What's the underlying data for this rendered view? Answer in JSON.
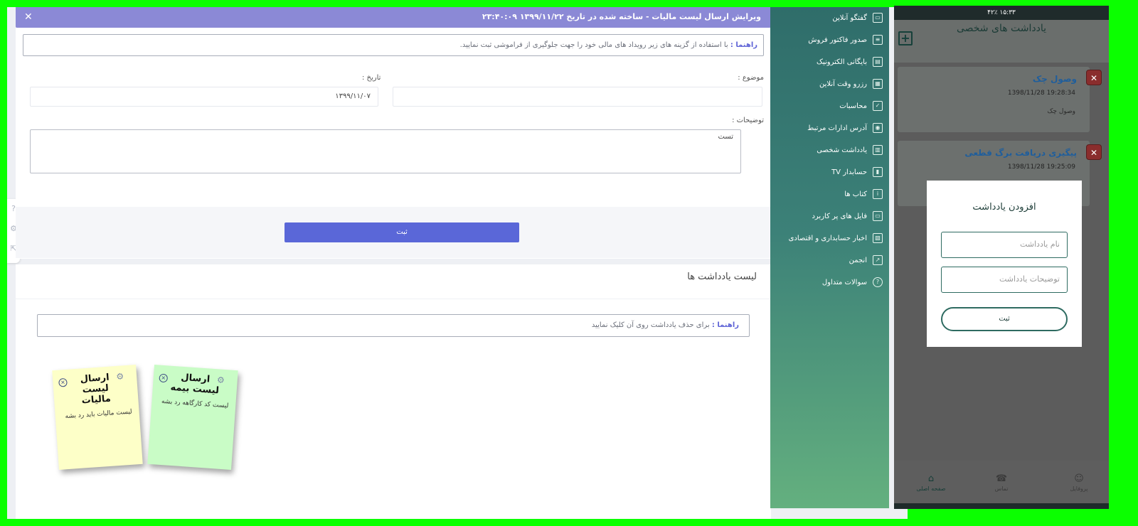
{
  "web": {
    "modal": {
      "title": "ویرایش ارسال لیست مالیات - ساخته شده در تاریخ ۱۳۹۹/۱۱/۲۲ ۲۳:۴۰:۰۹",
      "close": "✕"
    },
    "hint": {
      "label": "راهنما :",
      "text": "با استفاده از گزینه های زیر رویداد های مالی خود را جهت جلوگیری از فراموشی ثبت نمایید."
    },
    "form": {
      "subject_label": "موضوع :",
      "subject_value": "",
      "date_label": "تاریخ :",
      "date_value": "۱۳۹۹/۱۱/۰۷",
      "desc_label": "توضیحات :",
      "desc_value": "تست",
      "submit_label": "ثبت"
    },
    "list": {
      "title": "لیست یادداشت ها",
      "hint_label": "راهنما :",
      "hint_text": "برای حذف یادداشت روی آن کلیک نمایید"
    },
    "notes": [
      {
        "title": "ارسال لیست مالیات",
        "body": "لیست مالیات باید رد بشه",
        "color": "#fdffc8"
      },
      {
        "title": "ارسال لیست بیمه",
        "body": "لیست کد کارگاهه رد بشه",
        "color": "#c9fcc6"
      }
    ]
  },
  "sidebar": {
    "items": [
      {
        "label": "گفتگو آنلاین",
        "icon": "chat-icon"
      },
      {
        "label": "صدور فاکتور فروش",
        "icon": "invoice-icon"
      },
      {
        "label": "بایگانی الکترونیک",
        "icon": "archive-icon"
      },
      {
        "label": "رزرو وقت آنلاین",
        "icon": "calendar-icon"
      },
      {
        "label": "محاسبات",
        "icon": "clipboard-icon"
      },
      {
        "label": "آدرس ادارات مرتبط",
        "icon": "map-pin-icon"
      },
      {
        "label": "یادداشت شخصی",
        "icon": "notes-icon"
      },
      {
        "label": "حسابدار TV",
        "icon": "film-icon"
      },
      {
        "label": "کتاب ها",
        "icon": "book-icon"
      },
      {
        "label": "فایل های پر کاربرد",
        "icon": "file-icon"
      },
      {
        "label": "اخبار حسابداری و اقتصادی",
        "icon": "news-icon"
      },
      {
        "label": "انجمن",
        "icon": "forum-icon"
      },
      {
        "label": "سوالات متداول",
        "icon": "question-icon"
      }
    ]
  },
  "phone": {
    "status": "۱۵:۳۳  ۴۲٪",
    "title": "یادداشت های شخصی",
    "notes": [
      {
        "title": "وصول چک",
        "date": "1398/11/28 19:28:34",
        "desc": "وصول چک"
      },
      {
        "title": "پیگیری دریافت برگ قطعی",
        "date": "1398/11/28 19:25:09",
        "desc": ""
      }
    ],
    "dialog": {
      "title": "افزودن یادداشت",
      "name_placeholder": "نام یادداشت",
      "desc_placeholder": "توضیحات یادداشت",
      "submit": "ثبت"
    },
    "nav": {
      "profile": "پروفایل",
      "contact": "تماس",
      "home": "صفحه اصلی"
    }
  }
}
